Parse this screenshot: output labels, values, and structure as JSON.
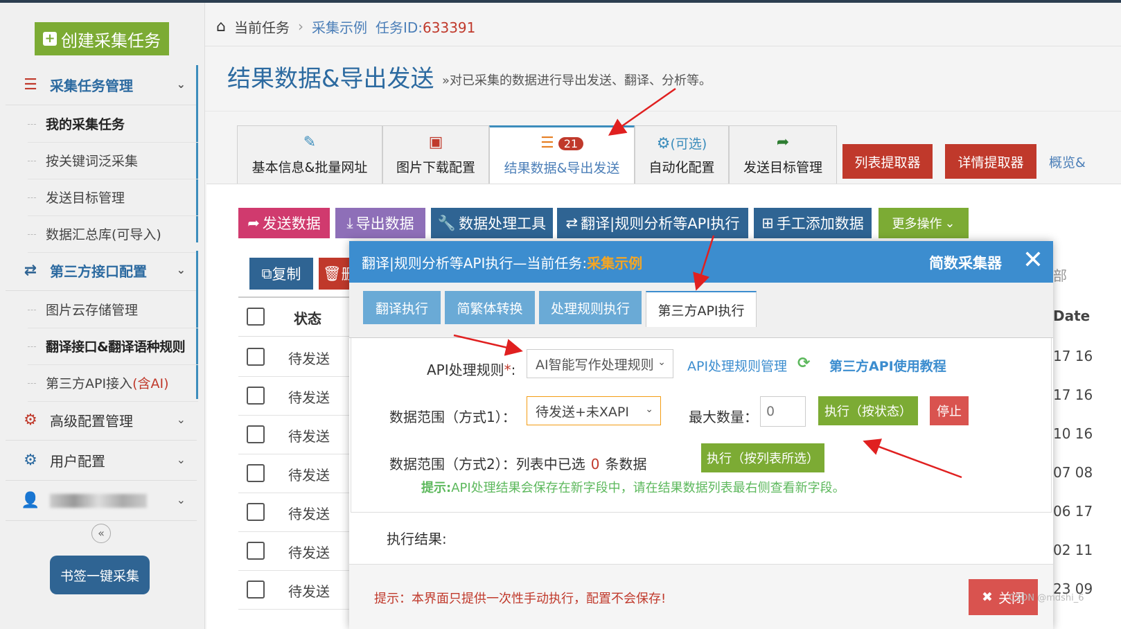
{
  "sidebar": {
    "create_button": "创建采集任务",
    "groups": [
      {
        "label": "采集任务管理",
        "icon": "list-icon"
      },
      {
        "label": "第三方接口配置",
        "icon": "exchange-icon"
      },
      {
        "label": "高级配置管理",
        "icon": "gears-icon"
      },
      {
        "label": "用户配置",
        "icon": "gear-icon"
      },
      {
        "label": "",
        "icon": "user-icon"
      }
    ],
    "task_items": [
      "我的采集任务",
      "按关键词泛采集",
      "发送目标管理",
      "数据汇总库(可导入)"
    ],
    "api_items": [
      "图片云存储管理",
      "翻译接口&翻译语种规则",
      "第三方API接入"
    ],
    "api_ai_suffix": "(含AI)",
    "collapse_glyph": "«",
    "bookmark_button": "书签一键采集"
  },
  "breadcrumb": {
    "current": "当前任务",
    "sep": "›",
    "task_name": "采集示例",
    "task_id_label": "任务ID:",
    "task_id": "633391"
  },
  "page": {
    "title": "结果数据&导出发送",
    "subtitle": "»对已采集的数据进行导出发送、翻译、分析等。"
  },
  "tabs": [
    {
      "label": "基本信息&批量网址",
      "icon": "edit-icon"
    },
    {
      "label": "图片下载配置",
      "icon": "image-icon"
    },
    {
      "label": "结果数据&导出发送",
      "icon": "database-icon",
      "badge": "21"
    },
    {
      "label": "自动化配置",
      "icon": "gears-icon",
      "extra": "(可选)"
    },
    {
      "label": "发送目标管理",
      "icon": "share-icon"
    }
  ],
  "extra_buttons": [
    "列表提取器",
    "详情提取器",
    "概览&"
  ],
  "actions": [
    "发送数据",
    "导出数据",
    "数据处理工具",
    "翻译|规则分析等API执行",
    "手工添加数据",
    "更多操作"
  ],
  "table": {
    "copy_button": "复制",
    "delete_button": "删",
    "status_header": "状态",
    "date_header": "Date",
    "statuses": [
      "待发送",
      "待发送",
      "待发送",
      "待发送",
      "待发送",
      "待发送",
      "待发送"
    ],
    "date_cells": [
      "17 16",
      "17 16",
      "10 16",
      "07 08",
      "06 17",
      "02 11",
      "23 09"
    ],
    "right_partial": "部"
  },
  "modal": {
    "title_prefix": "翻译|规则分析等API执行—当前任务: ",
    "task_name": "采集示例",
    "brand": "简数采集器",
    "close_glyph": "✕",
    "tabs": [
      "翻译执行",
      "简繁体转换",
      "处理规则执行",
      "第三方API执行"
    ],
    "api_rule_label": "API处理规则",
    "api_rule_required": "*",
    "api_rule_colon": ":",
    "api_rule_value": "AI智能写作处理规则",
    "api_rule_manage_link": "API处理规则管理",
    "tutorial_link": "第三方API使用教程",
    "range1_label": "数据范围（方式1）：",
    "range1_value": "待发送+未XAPI",
    "max_label": "最大数量：",
    "max_value": "0",
    "exec_status_button": "执行（按状态）",
    "stop_button": "停止",
    "range2_label": "数据范围（方式2）：",
    "range2_prefix": "列表中已选",
    "range2_count": "0",
    "range2_suffix": "条数据",
    "exec_selected_button": "执行（按列表所选）",
    "hint_label": "提示:",
    "hint_text": "API处理结果会保存在新字段中，请在结果数据列表最右侧查看新字段。",
    "result_label": "执行结果:",
    "footer_hint": "提示：本界面只提供一次性手动执行，配置不会保存!",
    "footer_close": "关闭"
  },
  "watermark": "CSDN @mdshi_6",
  "colors": {
    "accent_blue": "#3c8dcf",
    "create_green": "#7cab34",
    "danger_red": "#c0392b",
    "send_pink": "#d03a6e",
    "export_purple": "#8e6fb8",
    "tool_blue": "#2f6493",
    "arrow_red": "#e02020"
  }
}
